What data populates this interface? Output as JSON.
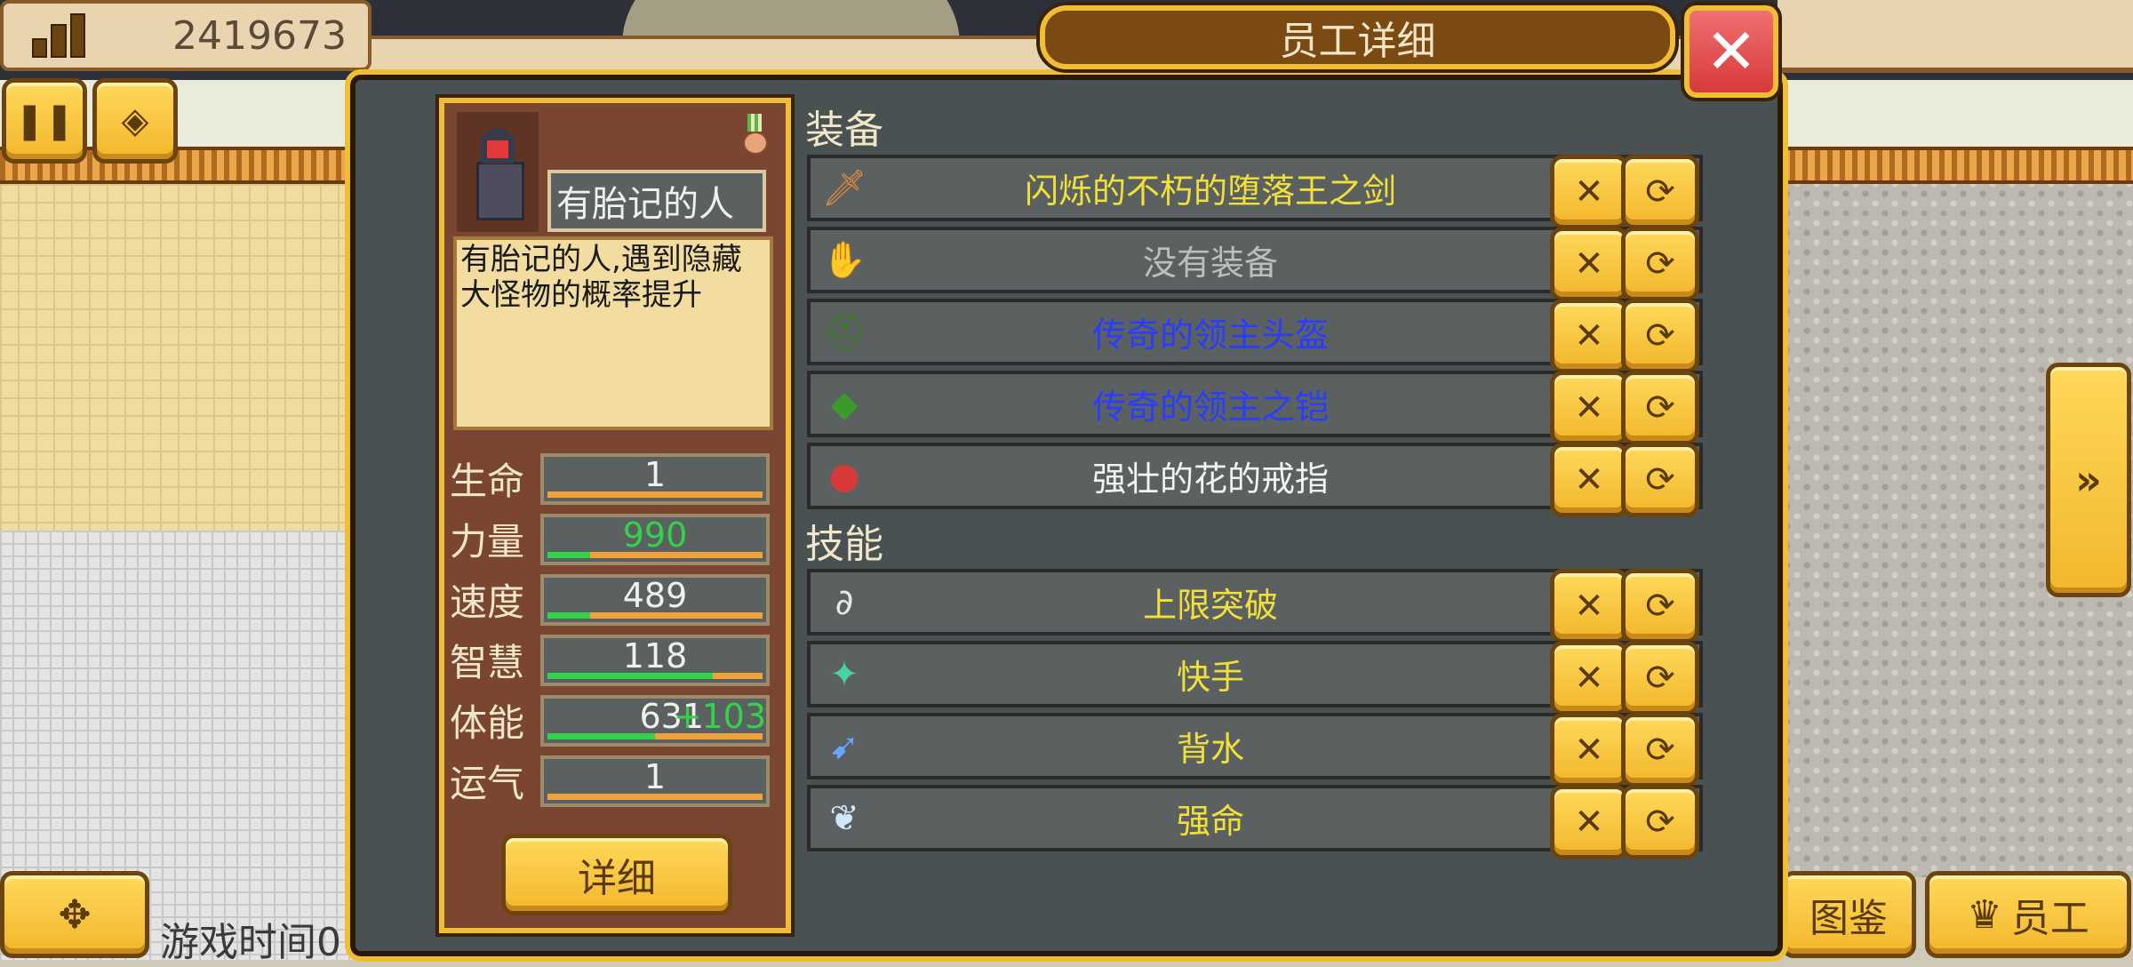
{
  "hud": {
    "money": "2419673",
    "game_time_label": "游戏时间0",
    "encyclopedia_label": "图鉴",
    "staff_label": "员工"
  },
  "dialog": {
    "title": "员工详细",
    "close_glyph": "✕"
  },
  "employee": {
    "name": "有胎记的人",
    "description": "有胎记的人,遇到隐藏大怪物的概率提升",
    "detail_button": "详细",
    "stats": [
      {
        "label": "生命",
        "value": "1",
        "fill": 0.0,
        "bonus": ""
      },
      {
        "label": "力量",
        "value": "990",
        "fill": 0.2,
        "bonus": "",
        "value_color": "#34d14a"
      },
      {
        "label": "速度",
        "value": "489",
        "fill": 0.2,
        "bonus": ""
      },
      {
        "label": "智慧",
        "value": "118",
        "fill": 0.77,
        "bonus": ""
      },
      {
        "label": "体能",
        "value": "631",
        "fill": 0.5,
        "bonus": "+103"
      },
      {
        "label": "运气",
        "value": "1",
        "fill": 0.0,
        "bonus": ""
      }
    ]
  },
  "equipment": {
    "heading": "装备",
    "items": [
      {
        "name": "闪烁的不朽的堕落王之剑",
        "color": "#f2e03a",
        "icon": "sword-icon"
      },
      {
        "name": "没有装备",
        "color": "#bdbdbd",
        "icon": "glove-icon"
      },
      {
        "name": "传奇的领主头盔",
        "color": "#2a3cff",
        "icon": "helmet-icon"
      },
      {
        "name": "传奇的领主之铠",
        "color": "#2a3cff",
        "icon": "armor-icon"
      },
      {
        "name": "强壮的花的戒指",
        "color": "#f4f4f4",
        "icon": "ring-icon"
      }
    ]
  },
  "skills": {
    "heading": "技能",
    "items": [
      {
        "name": "上限突破",
        "color": "#f2e03a",
        "icon": "chain-break-icon"
      },
      {
        "name": "快手",
        "color": "#f2e03a",
        "icon": "quick-hand-icon"
      },
      {
        "name": "背水",
        "color": "#f2e03a",
        "icon": "rocket-icon"
      },
      {
        "name": "强命",
        "color": "#f2e03a",
        "icon": "wing-icon"
      }
    ]
  }
}
